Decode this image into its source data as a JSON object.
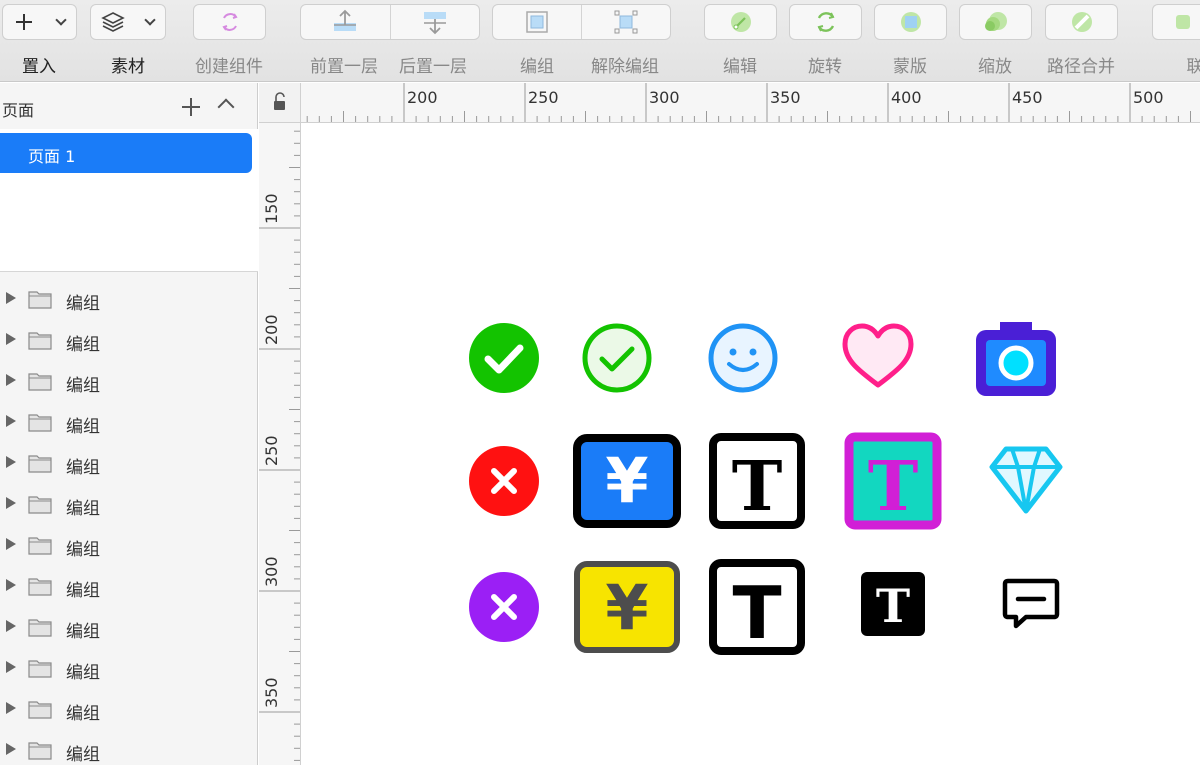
{
  "toolbar": {
    "items": [
      {
        "label": "置入",
        "icon": "plus-icon"
      },
      {
        "label": "素材",
        "icon": "layers-icon"
      },
      {
        "label": "创建组件",
        "icon": "symbol-icon"
      },
      {
        "label": "前置一层",
        "icon": "bring-forward-icon"
      },
      {
        "label": "后置一层",
        "icon": "send-backward-icon"
      },
      {
        "label": "编组",
        "icon": "group-icon"
      },
      {
        "label": "解除编组",
        "icon": "ungroup-icon"
      },
      {
        "label": "编辑",
        "icon": "edit-icon"
      },
      {
        "label": "旋转",
        "icon": "rotate-icon"
      },
      {
        "label": "蒙版",
        "icon": "mask-icon"
      },
      {
        "label": "缩放",
        "icon": "scale-icon"
      },
      {
        "label": "路径合并",
        "icon": "path-combine-icon"
      },
      {
        "label": "联"
      }
    ]
  },
  "sidebar": {
    "pages_title": "页面",
    "pages": [
      {
        "label": "页面 1",
        "selected": true
      }
    ],
    "layers": [
      "编组",
      "编组",
      "编组",
      "编组",
      "编组",
      "编组",
      "编组",
      "编组",
      "编组",
      "编组",
      "编组",
      "编组"
    ]
  },
  "rulers": {
    "horizontal": [
      "200",
      "250",
      "300",
      "350",
      "400",
      "450",
      "500"
    ],
    "vertical": [
      "150",
      "200",
      "250",
      "300",
      "350"
    ]
  },
  "canvas_icons": [
    {
      "name": "check-circle-filled-icon",
      "color": "#13c300"
    },
    {
      "name": "check-circle-outline-icon",
      "color": "#13c300"
    },
    {
      "name": "smile-icon",
      "color": "#1f93f5"
    },
    {
      "name": "heart-icon",
      "color": "#ff1f8a"
    },
    {
      "name": "camera-icon",
      "color": "#4a1fd6"
    },
    {
      "name": "close-circle-red-icon",
      "color": "#ff1111"
    },
    {
      "name": "yen-box-blue-icon",
      "color": "#1a7cf8"
    },
    {
      "name": "text-box-outline-icon",
      "color": "#000000"
    },
    {
      "name": "text-box-magenta-icon",
      "color": "#d11fd6"
    },
    {
      "name": "diamond-icon",
      "color": "#17c7f0"
    },
    {
      "name": "close-circle-purple-icon",
      "color": "#9b1ff5"
    },
    {
      "name": "yen-box-yellow-icon",
      "color": "#f7e400"
    },
    {
      "name": "text-box-outline-large-icon",
      "color": "#000000"
    },
    {
      "name": "text-box-filled-icon",
      "color": "#000000"
    },
    {
      "name": "message-icon",
      "color": "#000000"
    }
  ],
  "glyphs": {
    "yen": "¥",
    "text": "T"
  }
}
